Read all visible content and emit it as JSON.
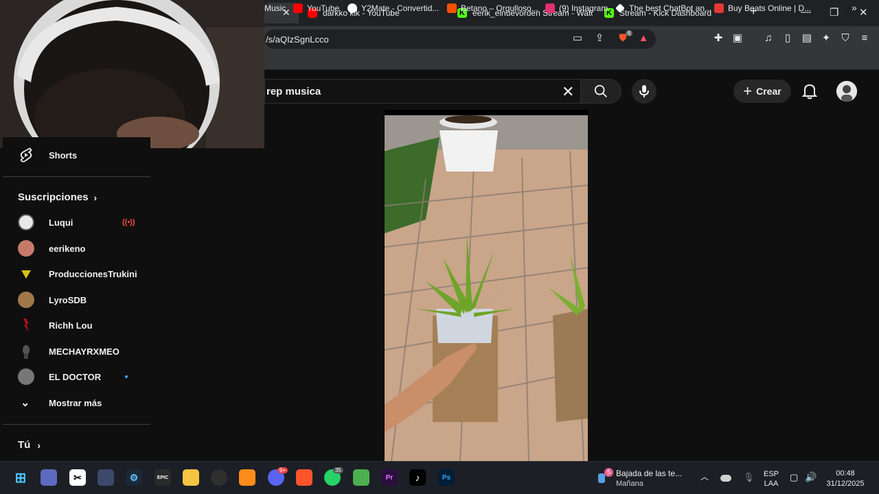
{
  "browser": {
    "tabs": [
      {
        "title": "",
        "active": true
      },
      {
        "title": "darkko klk - YouTube",
        "favicon": "youtube-icon"
      },
      {
        "title": "eerik_elnuevorden Stream - Watch",
        "favicon": "kick-icon"
      },
      {
        "title": "Stream - Kick Dashboard",
        "favicon": "kick-icon"
      }
    ],
    "kick_letter": "K",
    "new_tab": "+",
    "url": "/s/aQIzSgnLcco",
    "shields_count": "6",
    "bookmarks": [
      {
        "label": "Music",
        "icon": "music-icon",
        "color": "#ff0000"
      },
      {
        "label": "YouTube",
        "icon": "youtube-icon",
        "color": "#ff0000"
      },
      {
        "label": "Y2Mate - Convertid...",
        "icon": "y2mate-icon",
        "color": "#ffffff"
      },
      {
        "label": "Betano – Orgulloso...",
        "icon": "betano-icon",
        "color": "#ff5000"
      },
      {
        "label": "(9) Instagram",
        "icon": "instagram-icon",
        "color": "#e1306c"
      },
      {
        "label": "The best ChatBot an...",
        "icon": "chatbot-icon",
        "color": "#ffffff"
      },
      {
        "label": "Buy Beats Online | D...",
        "icon": "beats-icon",
        "color": "#e53935"
      }
    ]
  },
  "youtube": {
    "search_value": "rep musica",
    "create_label": "Crear",
    "sidebar": {
      "shorts_label": "Shorts",
      "subscriptions_title": "Suscripciones",
      "subscriptions": [
        {
          "name": "Luqui",
          "live": true,
          "color": "#e8e8e8"
        },
        {
          "name": "eerikeno",
          "color": "#c77a6a"
        },
        {
          "name": "ProduccionesTrukini",
          "color": "#d4c21a"
        },
        {
          "name": "LyroSDB",
          "color": "#a0784a"
        },
        {
          "name": "Richh Lou",
          "color": "#b01010"
        },
        {
          "name": "MECHAYRXMEO",
          "color": "#555555"
        },
        {
          "name": "EL DOCTOR",
          "new_content": true,
          "color": "#777777"
        }
      ],
      "show_more_label": "Mostrar más",
      "you_title": "Tú"
    }
  },
  "taskbar": {
    "notification_badge": "5",
    "weather_title": "Bajada de las te...",
    "weather_sub": "Mañana",
    "language": "ESP",
    "language_sub": "LAA",
    "time": "00:48",
    "date": "31/12/2025",
    "whatsapp_badge": "35",
    "discord_badge": "9+"
  }
}
